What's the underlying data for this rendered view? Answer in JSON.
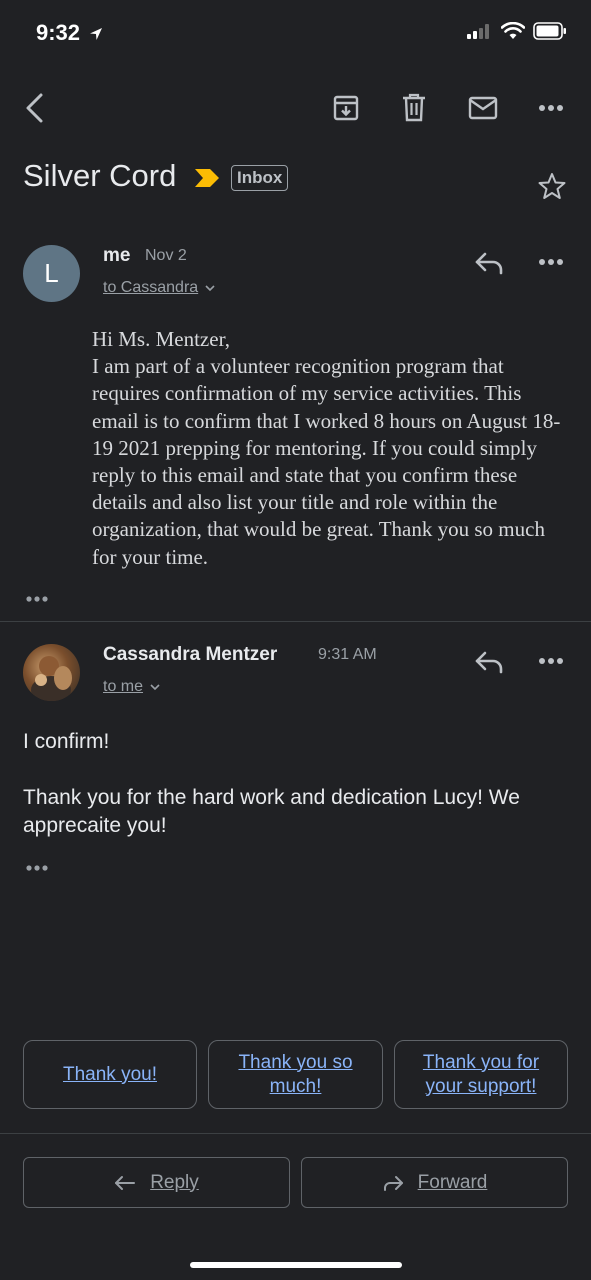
{
  "status": {
    "time": "9:32"
  },
  "email": {
    "subject": "Silver Cord",
    "label": "Inbox",
    "messages": [
      {
        "avatar_letter": "L",
        "sender": "me",
        "date": "Nov 2",
        "recipient": "to Cassandra",
        "body": [
          "Hi Ms. Mentzer,",
          "I am part of a volunteer recognition program that requires confirmation of my service activities. This email is to confirm that I worked 8 hours on August 18-19 2021 prepping for mentoring. If you could simply reply to this email and state that you confirm these details and also list your title and role within the organization, that would be great. Thank you so much for your time."
        ]
      },
      {
        "sender": "Cassandra Mentzer",
        "date": "9:31 AM",
        "recipient": "to me",
        "body": [
          "I confirm!",
          "Thank you for the hard work and dedication Lucy! We apprecaite you!"
        ]
      }
    ]
  },
  "smart_replies": [
    "Thank you!",
    "Thank you so much!",
    "Thank you for your support!"
  ],
  "actions": {
    "reply": "Reply",
    "forward": "Forward"
  },
  "colors": {
    "background": "#202124",
    "accent": "#8ab4f8",
    "important_marker": "#fbbc04"
  }
}
